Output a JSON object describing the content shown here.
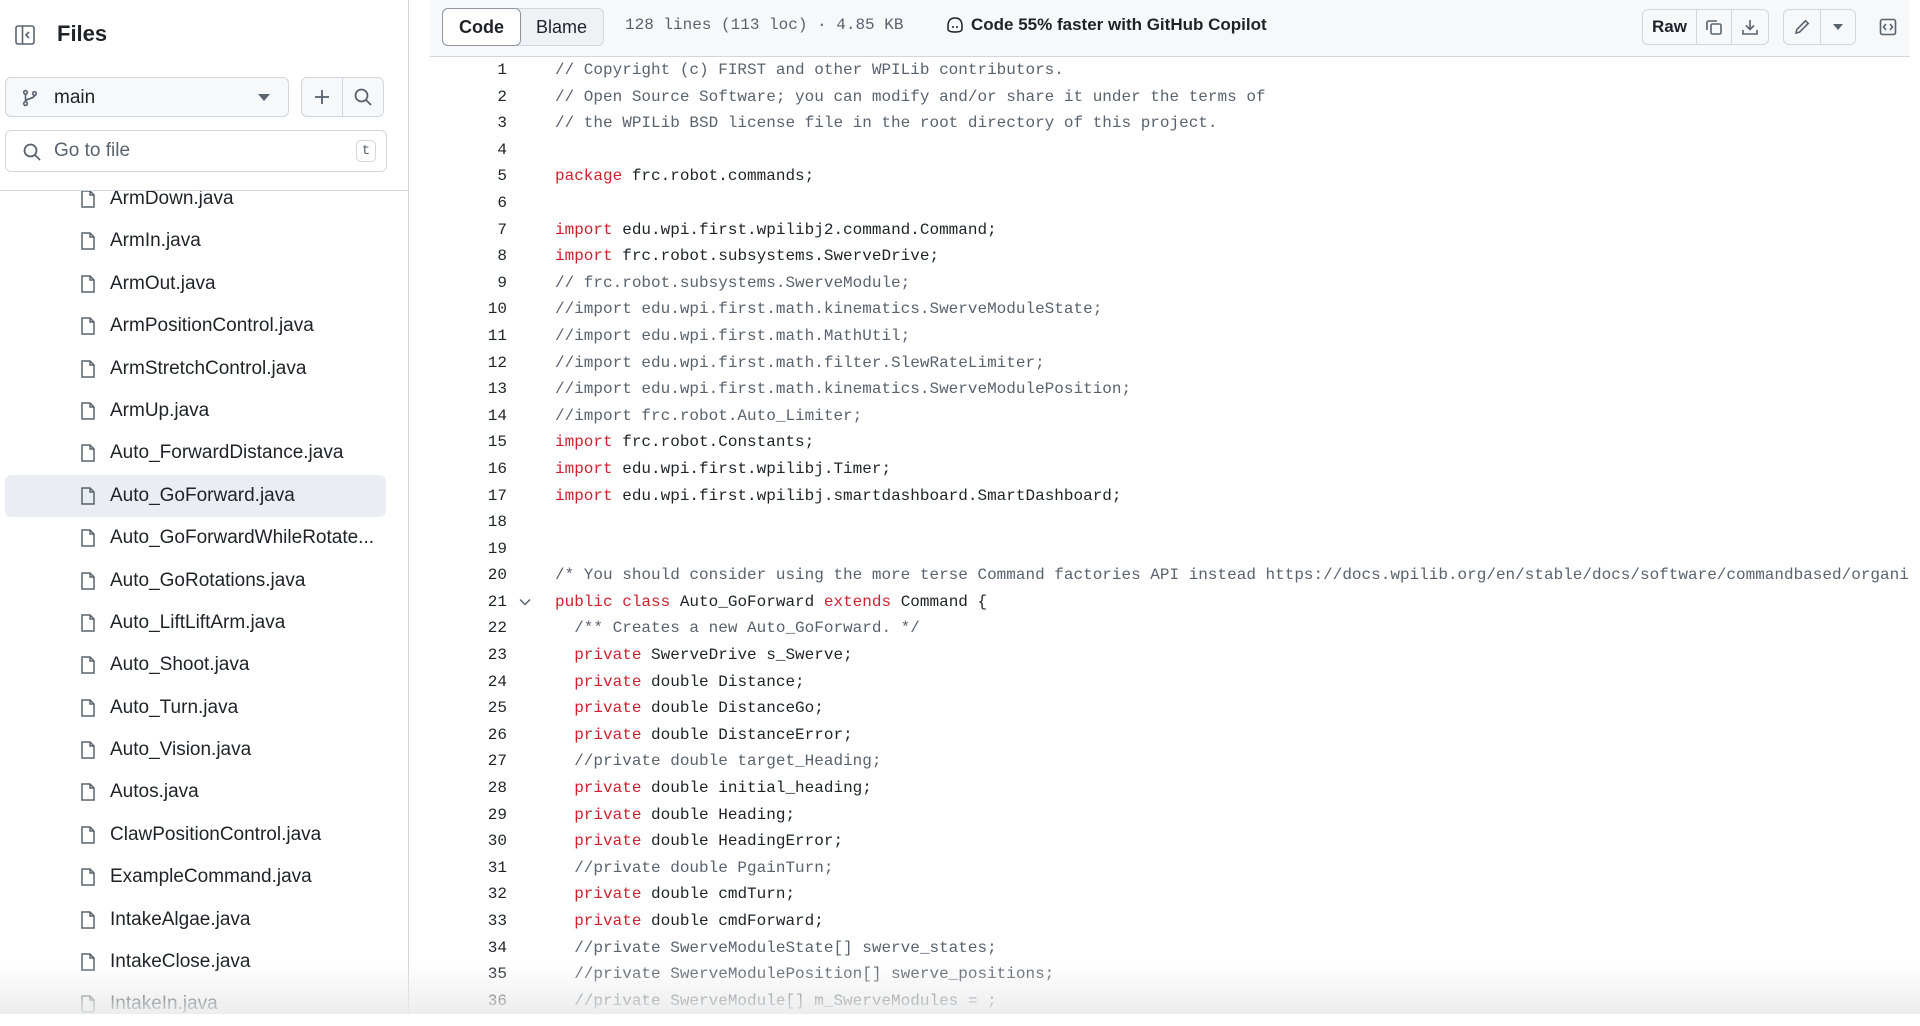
{
  "sidebar": {
    "title": "Files",
    "branch": "main",
    "goto_placeholder": "Go to file",
    "goto_shortcut": "t",
    "files": [
      "ArmDown.java",
      "ArmIn.java",
      "ArmOut.java",
      "ArmPositionControl.java",
      "ArmStretchControl.java",
      "ArmUp.java",
      "Auto_ForwardDistance.java",
      "Auto_GoForward.java",
      "Auto_GoForwardWhileRotate...",
      "Auto_GoRotations.java",
      "Auto_LiftLiftArm.java",
      "Auto_Shoot.java",
      "Auto_Turn.java",
      "Auto_Vision.java",
      "Autos.java",
      "ClawPositionControl.java",
      "ExampleCommand.java",
      "IntakeAlgae.java",
      "IntakeClose.java",
      "IntakeIn.java"
    ],
    "selected_file": "Auto_GoForward.java"
  },
  "toolbar": {
    "code_tab": "Code",
    "blame_tab": "Blame",
    "file_info": "128 lines (113 loc) · 4.85 KB",
    "copilot_text": "Code 55% faster with GitHub Copilot",
    "raw_label": "Raw"
  },
  "code": {
    "lines": [
      [
        [
          "cm",
          "// Copyright (c) FIRST and other WPILib contributors."
        ]
      ],
      [
        [
          "cm",
          "// Open Source Software; you can modify and/or share it under the terms of"
        ]
      ],
      [
        [
          "cm",
          "// the WPILib BSD license file in the root directory of this project."
        ]
      ],
      [],
      [
        [
          "kw",
          "package"
        ],
        [
          "",
          "frc.robot.commands;"
        ]
      ],
      [],
      [
        [
          "kw",
          "import"
        ],
        [
          "",
          "edu.wpi.first.wpilibj2.command.Command;"
        ]
      ],
      [
        [
          "kw",
          "import"
        ],
        [
          "",
          "frc.robot.subsystems.SwerveDrive;"
        ]
      ],
      [
        [
          "cm",
          "// frc.robot.subsystems.SwerveModule;"
        ]
      ],
      [
        [
          "cm",
          "//import edu.wpi.first.math.kinematics.SwerveModuleState;"
        ]
      ],
      [
        [
          "cm",
          "//import edu.wpi.first.math.MathUtil;"
        ]
      ],
      [
        [
          "cm",
          "//import edu.wpi.first.math.filter.SlewRateLimiter;"
        ]
      ],
      [
        [
          "cm",
          "//import edu.wpi.first.math.kinematics.SwerveModulePosition;"
        ]
      ],
      [
        [
          "cm",
          "//import frc.robot.Auto_Limiter;"
        ]
      ],
      [
        [
          "kw",
          "import"
        ],
        [
          "",
          "frc.robot.Constants;"
        ]
      ],
      [
        [
          "kw",
          "import"
        ],
        [
          "",
          "edu.wpi.first.wpilibj.Timer;"
        ]
      ],
      [
        [
          "kw",
          "import"
        ],
        [
          "",
          "edu.wpi.first.wpilibj.smartdashboard.SmartDashboard;"
        ]
      ],
      [],
      [],
      [
        [
          "cm",
          "/* You should consider using the more terse Command factories API instead https://docs.wpilib.org/en/stable/docs/software/commandbased/organizing-command-based.html"
        ]
      ],
      [
        [
          "kw",
          "public class"
        ],
        [
          "",
          "Auto_GoForward"
        ],
        [
          "kw",
          "extends"
        ],
        [
          "",
          "Command {"
        ]
      ],
      [
        [
          "cm",
          "  /** Creates a new Auto_GoForward. */"
        ]
      ],
      [
        [
          "kw",
          "  private"
        ],
        [
          "",
          "SwerveDrive s_Swerve;"
        ]
      ],
      [
        [
          "kw",
          "  private"
        ],
        [
          "",
          "double Distance;"
        ]
      ],
      [
        [
          "kw",
          "  private"
        ],
        [
          "",
          "double DistanceGo;"
        ]
      ],
      [
        [
          "kw",
          "  private"
        ],
        [
          "",
          "double DistanceError;"
        ]
      ],
      [
        [
          "cm",
          "  //private double target_Heading;"
        ]
      ],
      [
        [
          "kw",
          "  private"
        ],
        [
          "",
          "double initial_heading;"
        ]
      ],
      [
        [
          "kw",
          "  private"
        ],
        [
          "",
          "double Heading;"
        ]
      ],
      [
        [
          "kw",
          "  private"
        ],
        [
          "",
          "double HeadingError;"
        ]
      ],
      [
        [
          "cm",
          "  //private double PgainTurn;"
        ]
      ],
      [
        [
          "kw",
          "  private"
        ],
        [
          "",
          "double cmdTurn;"
        ]
      ],
      [
        [
          "kw",
          "  private"
        ],
        [
          "",
          "double cmdForward;"
        ]
      ],
      [
        [
          "cm",
          "  //private SwerveModuleState[] swerve_states;"
        ]
      ],
      [
        [
          "cm",
          "  //private SwerveModulePosition[] swerve_positions;"
        ]
      ],
      [
        [
          "cm",
          "  //private SwerveModule[] m_SwerveModules = ;"
        ]
      ]
    ],
    "fold_line": 21
  }
}
